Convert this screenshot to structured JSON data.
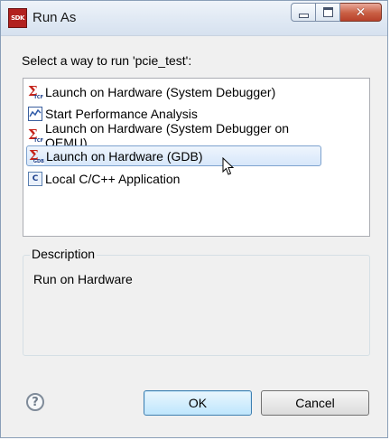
{
  "window": {
    "title": "Run As",
    "app_icon_text": "SDK",
    "controls": {
      "minimize": "minimize",
      "maximize": "maximize",
      "close": "✕"
    }
  },
  "prompt": "Select a way to run 'pcie_test':",
  "launch_options": [
    {
      "label": "Launch on Hardware (System Debugger)",
      "icon": "xilinx-sigma-tcf-icon",
      "icon_sub": "TCF",
      "selected": false
    },
    {
      "label": "Start Performance Analysis",
      "icon": "performance-chart-icon",
      "icon_sub": "",
      "selected": false
    },
    {
      "label": "Launch on Hardware (System Debugger on QEMU)",
      "icon": "xilinx-sigma-tcf-icon",
      "icon_sub": "TCF",
      "selected": false
    },
    {
      "label": "Launch on Hardware (GDB)",
      "icon": "xilinx-sigma-gdb-icon",
      "icon_sub": "GDB",
      "selected": true
    },
    {
      "label": "Local C/C++ Application",
      "icon": "c-application-icon",
      "icon_sub": "C",
      "selected": false
    }
  ],
  "description": {
    "legend": "Description",
    "text": "Run on Hardware"
  },
  "buttons": {
    "help": "?",
    "ok": "OK",
    "cancel": "Cancel"
  },
  "colors": {
    "selection_border": "#7da2ce",
    "xilinx_red": "#c5241c",
    "ok_border": "#3c7fb1"
  }
}
